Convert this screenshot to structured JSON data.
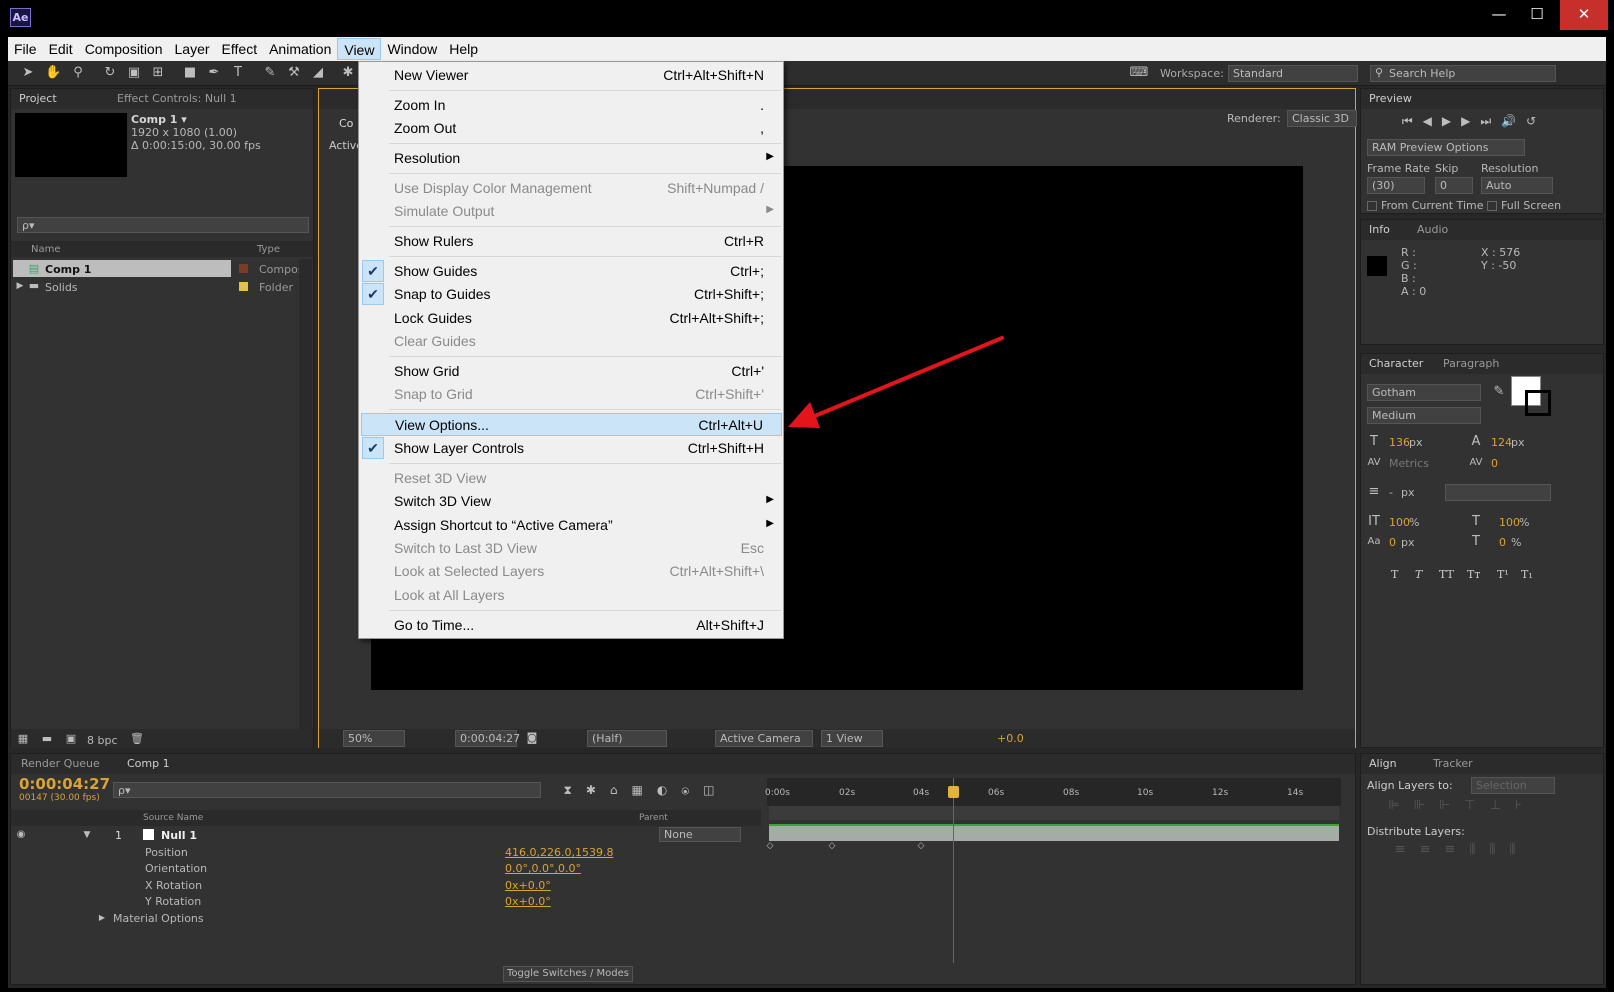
{
  "title_bar": {
    "logo": "Ae",
    "minimize": "—",
    "maximize": "☐",
    "close": "✕"
  },
  "menubar": [
    "File",
    "Edit",
    "Composition",
    "Layer",
    "Effect",
    "Animation",
    "View",
    "Window",
    "Help"
  ],
  "toolbar": {
    "workspace_label": "Workspace:",
    "workspace_value": "Standard",
    "search_help": "Search Help"
  },
  "project_panel": {
    "tab_project": "Project",
    "tab_effect_controls": "Effect Controls: Null 1",
    "comp_name": "Comp 1 ▾",
    "comp_res": "1920 x 1080 (1.00)",
    "comp_dur": "Δ 0:00:15:00, 30.00 fps",
    "search_placeholder": "ρ▾",
    "col_name": "Name",
    "col_type": "Type",
    "items": [
      {
        "name": "Comp 1",
        "type": "Compos"
      },
      {
        "name": "Solids",
        "type": "Folder"
      }
    ],
    "bpc": "8 bpc"
  },
  "comp_panel": {
    "active_label": "Active",
    "tab_prefix": "Co",
    "renderer_label": "Renderer:",
    "renderer_value": "Classic 3D",
    "zoom": "50%",
    "timecode": "0:00:04:27",
    "resolution": "(Half)",
    "camera": "Active Camera",
    "views": "1 View",
    "exposure": "+0.0"
  },
  "view_menu": {
    "items": [
      {
        "label": "New Viewer",
        "shortcut": "Ctrl+Alt+Shift+N",
        "state": "normal"
      },
      {
        "label": "Zoom In",
        "shortcut": ".",
        "state": "normal"
      },
      {
        "label": "Zoom Out",
        "shortcut": ",",
        "state": "normal"
      },
      {
        "label": "Resolution",
        "shortcut": "",
        "state": "normal",
        "submenu": true
      },
      {
        "label": "Use Display Color Management",
        "shortcut": "Shift+Numpad /",
        "state": "disabled"
      },
      {
        "label": "Simulate Output",
        "shortcut": "",
        "state": "disabled",
        "submenu": true
      },
      {
        "label": "Show Rulers",
        "shortcut": "Ctrl+R",
        "state": "normal"
      },
      {
        "label": "Show Guides",
        "shortcut": "Ctrl+;",
        "state": "checked"
      },
      {
        "label": "Snap to Guides",
        "shortcut": "Ctrl+Shift+;",
        "state": "checked"
      },
      {
        "label": "Lock Guides",
        "shortcut": "Ctrl+Alt+Shift+;",
        "state": "normal"
      },
      {
        "label": "Clear Guides",
        "shortcut": "",
        "state": "disabled"
      },
      {
        "label": "Show Grid",
        "shortcut": "Ctrl+'",
        "state": "normal"
      },
      {
        "label": "Snap to Grid",
        "shortcut": "Ctrl+Shift+'",
        "state": "disabled"
      },
      {
        "label": "View Options...",
        "shortcut": "Ctrl+Alt+U",
        "state": "highlighted"
      },
      {
        "label": "Show Layer Controls",
        "shortcut": "Ctrl+Shift+H",
        "state": "checked"
      },
      {
        "label": "Reset 3D View",
        "shortcut": "",
        "state": "disabled"
      },
      {
        "label": "Switch 3D View",
        "shortcut": "",
        "state": "normal",
        "submenu": true
      },
      {
        "label": "Assign Shortcut to “Active Camera”",
        "shortcut": "",
        "state": "normal",
        "submenu": true
      },
      {
        "label": "Switch to Last 3D View",
        "shortcut": "Esc",
        "state": "disabled"
      },
      {
        "label": "Look at Selected Layers",
        "shortcut": "Ctrl+Alt+Shift+\\",
        "state": "disabled"
      },
      {
        "label": "Look at All Layers",
        "shortcut": "",
        "state": "disabled"
      },
      {
        "label": "Go to Time...",
        "shortcut": "Alt+Shift+J",
        "state": "normal"
      }
    ]
  },
  "preview_panel": {
    "tab": "Preview",
    "ram_options": "RAM Preview Options",
    "frame_rate_label": "Frame Rate",
    "skip_label": "Skip",
    "resolution_label": "Resolution",
    "frame_rate": "(30)",
    "skip": "0",
    "resolution": "Auto",
    "from_current": "From Current Time",
    "full_screen": "Full Screen"
  },
  "info_panel": {
    "tab_info": "Info",
    "tab_audio": "Audio",
    "r": "R :",
    "g": "G :",
    "b": "B :",
    "a": "A : 0",
    "x": "X : 576",
    "y": "Y : -50"
  },
  "character_panel": {
    "tab_character": "Character",
    "tab_paragraph": "Paragraph",
    "font": "Gotham",
    "style": "Medium",
    "size": "136",
    "size_unit": "px",
    "leading": "124",
    "leading_unit": "px",
    "kerning": "Metrics",
    "tracking": "0",
    "stroke": "-",
    "stroke_unit": "px",
    "vscale": "100",
    "vscale_unit": "%",
    "hscale": "100",
    "hscale_unit": "%",
    "baseline": "0",
    "baseline_unit": "px",
    "tsume": "0",
    "tsume_unit": "%",
    "styles": [
      "T",
      "T",
      "TT",
      "Tт",
      "T¹",
      "T₁"
    ]
  },
  "align_panel": {
    "tab_align": "Align",
    "tab_tracker": "Tracker",
    "align_to_label": "Align Layers to:",
    "align_to_value": "Selection",
    "distribute_label": "Distribute Layers:"
  },
  "timeline": {
    "tab_render": "Render Queue",
    "tab_comp": "Comp 1",
    "timecode": "0:00:04:27",
    "frames": "00147 (30.00 fps)",
    "search": "ρ▾",
    "col_source": "Source Name",
    "col_parent": "Parent",
    "layer_num": "1",
    "layer_name": "Null 1",
    "parent_value": "None",
    "props": [
      {
        "name": "Position",
        "value": "416.0,226.0,1539.8"
      },
      {
        "name": "Orientation",
        "value": "0.0°,0.0°,0.0°"
      },
      {
        "name": "X Rotation",
        "value": "0x+0.0°"
      },
      {
        "name": "Y Rotation",
        "value": "0x+0.0°"
      }
    ],
    "material": "Material Options",
    "toggle": "Toggle Switches / Modes",
    "ruler": [
      "0:00s",
      "02s",
      "04s",
      "06s",
      "08s",
      "10s",
      "12s",
      "14s"
    ]
  },
  "colors": {
    "accent": "#d9a336",
    "highlight": "#cce4f7",
    "arrow": "#e3141b"
  }
}
